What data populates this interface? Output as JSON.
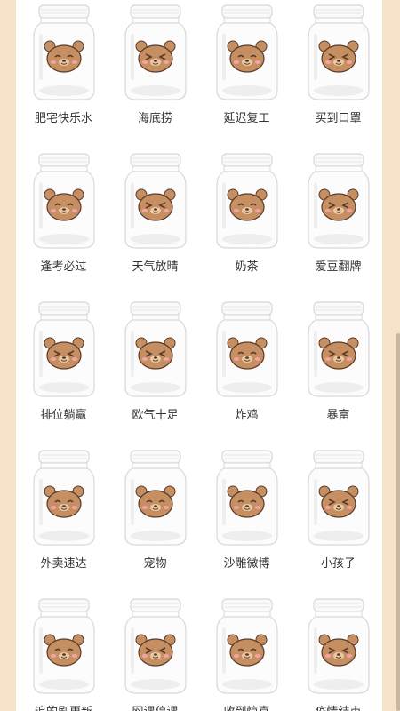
{
  "wishes": [
    {
      "label": "肥宅快乐水",
      "face": "happy"
    },
    {
      "label": "海底捞",
      "face": "angry"
    },
    {
      "label": "延迟复工",
      "face": "happy"
    },
    {
      "label": "买到口罩",
      "face": "angry"
    },
    {
      "label": "逢考必过",
      "face": "happy"
    },
    {
      "label": "天气放晴",
      "face": "angry"
    },
    {
      "label": "奶茶",
      "face": "happy"
    },
    {
      "label": "爱豆翻牌",
      "face": "angry"
    },
    {
      "label": "排位躺赢",
      "face": "angry"
    },
    {
      "label": "欧气十足",
      "face": "angry"
    },
    {
      "label": "炸鸡",
      "face": "happy"
    },
    {
      "label": "暴富",
      "face": "angry"
    },
    {
      "label": "外卖速达",
      "face": "happy"
    },
    {
      "label": "宠物",
      "face": "happy"
    },
    {
      "label": "沙雕微博",
      "face": "happy"
    },
    {
      "label": "小孩子",
      "face": "angry"
    },
    {
      "label": "追的剧更新",
      "face": "happy"
    },
    {
      "label": "网课停课",
      "face": "angry"
    },
    {
      "label": "收到惊喜",
      "face": "happy"
    },
    {
      "label": "疫情结束",
      "face": "angry"
    }
  ],
  "colors": {
    "background": "#f6e3c8",
    "bear": "#c68f61",
    "bear_dark": "#5a3a28",
    "cheek": "#f2a3a3",
    "jar_stroke": "#d8d8d8"
  }
}
